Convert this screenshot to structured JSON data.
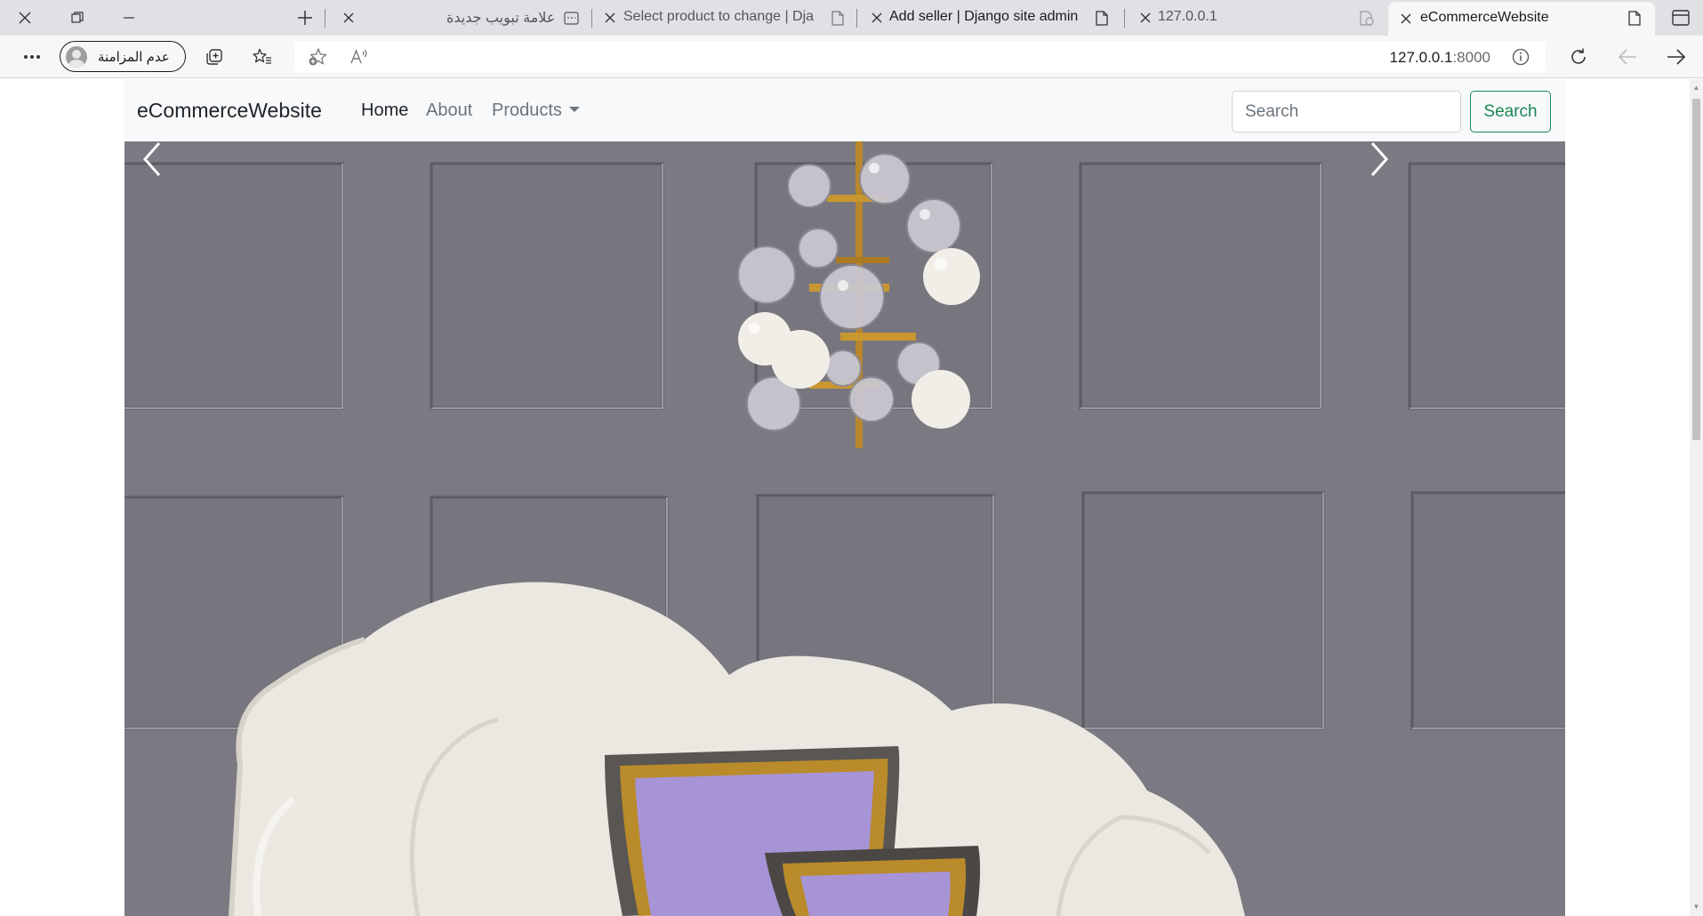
{
  "browser": {
    "tabs": [
      {
        "title": "علامة تبويب جديدة",
        "icon": "new-tab-page-icon"
      },
      {
        "title": "Select product to change | Djang",
        "icon": "page-icon"
      },
      {
        "title": "Add seller | Django site admin",
        "icon": "page-icon"
      },
      {
        "title": "127.0.0.1",
        "icon": "page-icon"
      },
      {
        "title": "eCommerceWebsite",
        "icon": "page-icon"
      }
    ],
    "url_host": "127.0.0.1",
    "url_port": ":8000",
    "profile_label": "عدم المزامنة"
  },
  "site": {
    "brand": "eCommerceWebsite",
    "nav": {
      "home": "Home",
      "about": "About",
      "products": "Products"
    },
    "search": {
      "placeholder": "Search",
      "button": "Search"
    }
  },
  "colors": {
    "navbar_bg": "#f8f9fa",
    "search_button": "#198754",
    "wall": "#7b7a82"
  }
}
